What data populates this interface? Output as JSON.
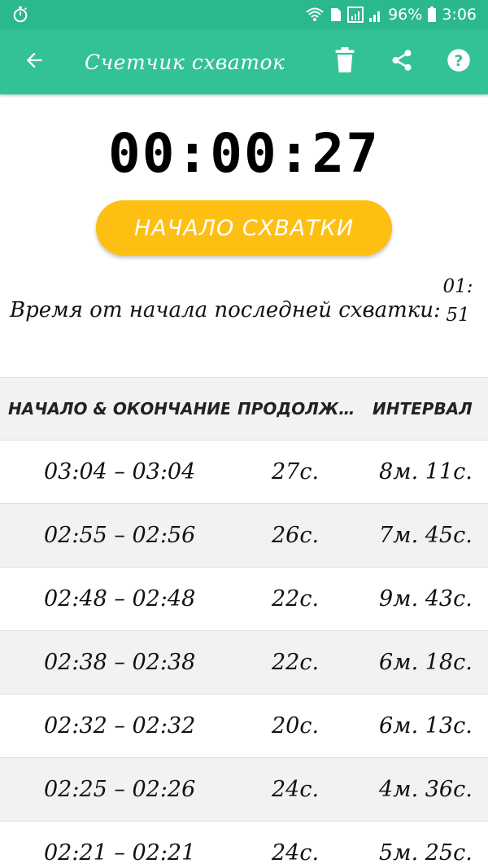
{
  "status_bar": {
    "battery": "96%",
    "time": "3:06"
  },
  "app_bar": {
    "title": "Счетчик схваток"
  },
  "timer": {
    "value": "00:00:27"
  },
  "start_button": {
    "label": "НАЧАЛО СХВАТКИ"
  },
  "last_contraction": {
    "label": "Время от начала последней схватки:",
    "value": "01:51"
  },
  "table": {
    "headers": [
      "НАЧАЛО & ОКОНЧАНИЕ",
      "ПРОДОЛЖИ...",
      "ИНТЕРВАЛ"
    ],
    "rows": [
      {
        "range": "03:04 – 03:04",
        "duration": "27с.",
        "interval": "8м. 11с."
      },
      {
        "range": "02:55 – 02:56",
        "duration": "26с.",
        "interval": "7м. 45с."
      },
      {
        "range": "02:48 – 02:48",
        "duration": "22с.",
        "interval": "9м. 43с."
      },
      {
        "range": "02:38 – 02:38",
        "duration": "22с.",
        "interval": "6м. 18с."
      },
      {
        "range": "02:32 – 02:32",
        "duration": "20с.",
        "interval": "6м. 13с."
      },
      {
        "range": "02:25 – 02:26",
        "duration": "24с.",
        "interval": "4м. 36с."
      },
      {
        "range": "02:21 – 02:21",
        "duration": "24с.",
        "interval": "5м. 25с."
      }
    ]
  },
  "colors": {
    "status_bar": "#2bb88c",
    "app_bar": "#33c295",
    "accent_button": "#fdc012"
  },
  "icons": {
    "status_left": "stopwatch-icon",
    "back": "arrow-back-icon",
    "delete": "trash-icon",
    "share": "share-icon",
    "help": "help-icon"
  }
}
